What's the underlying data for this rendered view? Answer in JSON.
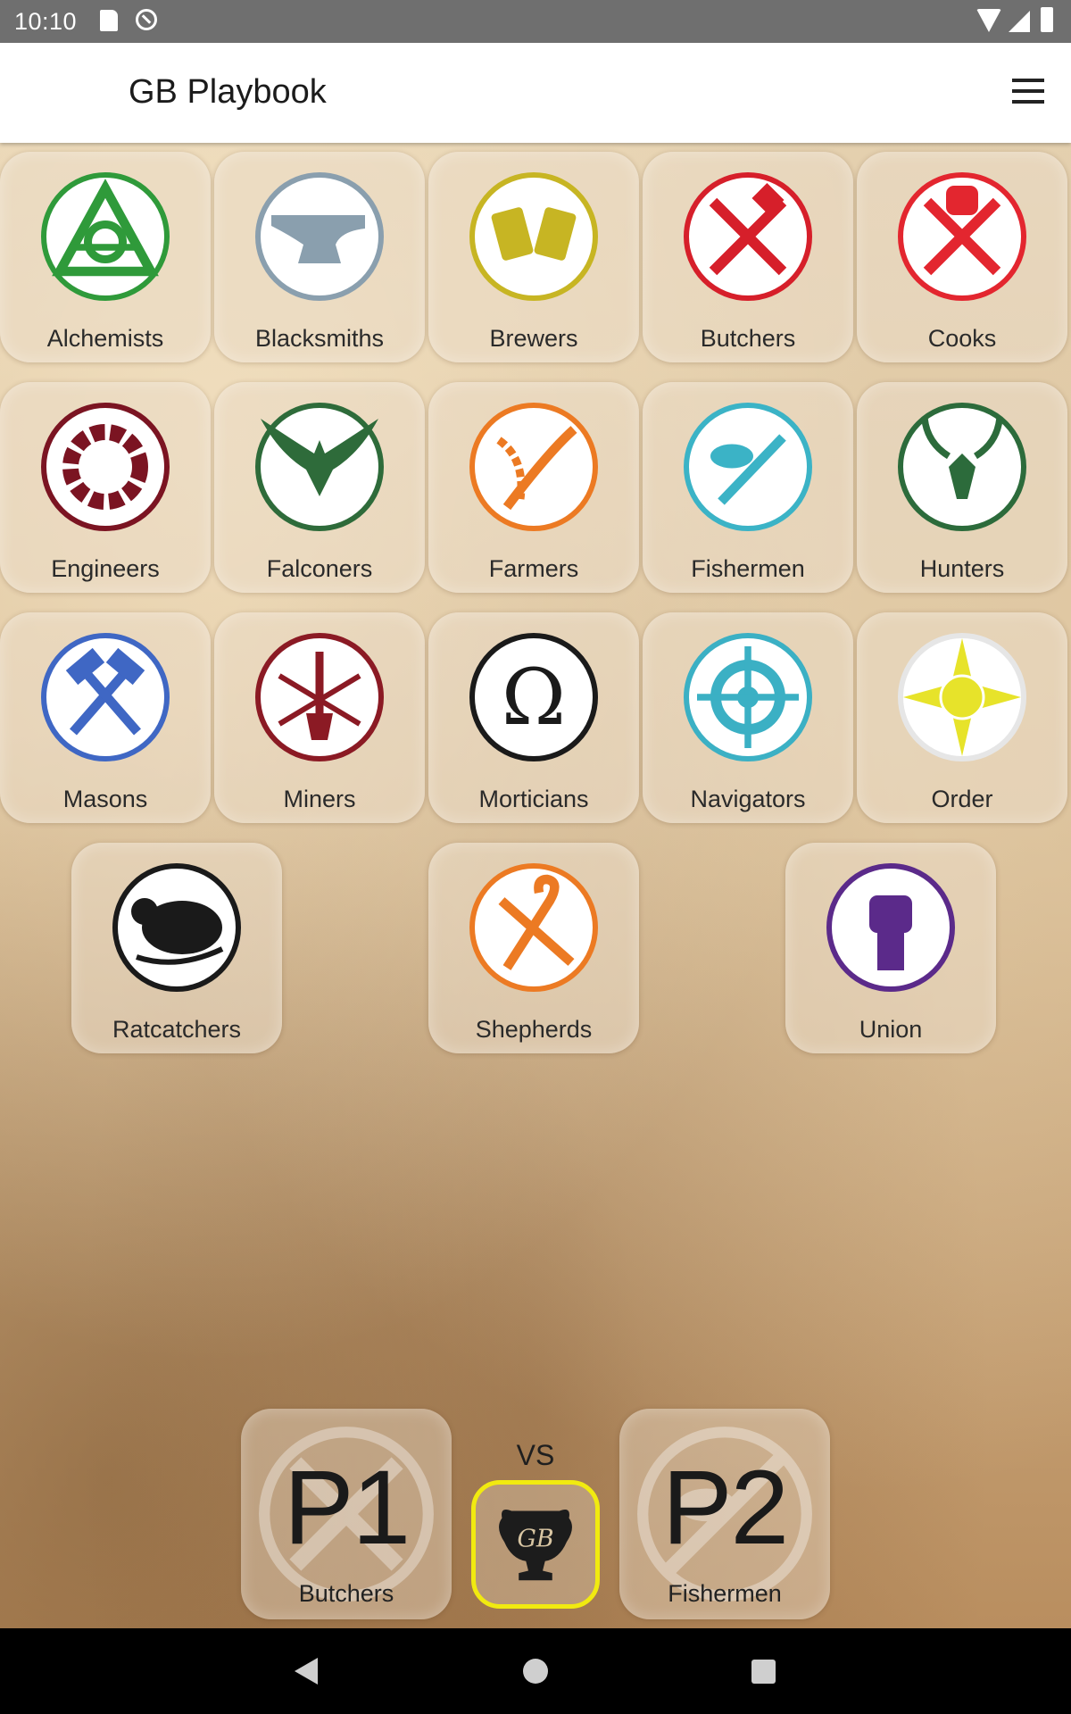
{
  "status": {
    "time": "10:10"
  },
  "app": {
    "title": "GB Playbook"
  },
  "guilds": [
    {
      "name": "Alchemists",
      "color": "#2f9a3a",
      "icon": "alchemist-triangle-icon"
    },
    {
      "name": "Blacksmiths",
      "color": "#8a9fae",
      "icon": "anvil-icon"
    },
    {
      "name": "Brewers",
      "color": "#c7b523",
      "icon": "beer-mugs-icon"
    },
    {
      "name": "Butchers",
      "color": "#d61f2a",
      "icon": "crossed-cleaver-knife-icon"
    },
    {
      "name": "Cooks",
      "color": "#e3262f",
      "icon": "chef-hat-crossed-utensils-icon"
    },
    {
      "name": "Engineers",
      "color": "#7b1422",
      "icon": "gear-icon"
    },
    {
      "name": "Falconers",
      "color": "#2e6b3a",
      "icon": "falcon-icon"
    },
    {
      "name": "Farmers",
      "color": "#ec7a23",
      "icon": "wheat-scythe-icon"
    },
    {
      "name": "Fishermen",
      "color": "#3bb3c6",
      "icon": "fish-knife-icon"
    },
    {
      "name": "Hunters",
      "color": "#2c6b3b",
      "icon": "stag-skull-icon"
    },
    {
      "name": "Masons",
      "color": "#3f67c4",
      "icon": "crossed-hammers-icon"
    },
    {
      "name": "Miners",
      "color": "#8b1a24",
      "icon": "pick-shovel-icon"
    },
    {
      "name": "Morticians",
      "color": "#1a1a1a",
      "icon": "omega-icon"
    },
    {
      "name": "Navigators",
      "color": "#3bb0c4",
      "icon": "ship-wheel-anchor-icon"
    },
    {
      "name": "Order",
      "color": "#e7e32a",
      "icon": "sun-star-icon"
    },
    {
      "name": "Ratcatchers",
      "color": "#1a1a1a",
      "icon": "rat-icon"
    },
    {
      "name": "Shepherds",
      "color": "#ec7a23",
      "icon": "crook-shears-icon"
    },
    {
      "name": "Union",
      "color": "#5b2a8a",
      "icon": "raised-fist-icon"
    }
  ],
  "matchup": {
    "player1": {
      "label": "P1",
      "team": "Butchers"
    },
    "vs": "VS",
    "player2": {
      "label": "P2",
      "team": "Fishermen"
    },
    "start_icon": "gb-trophy-icon",
    "highlight_color": "#f1ea10"
  }
}
